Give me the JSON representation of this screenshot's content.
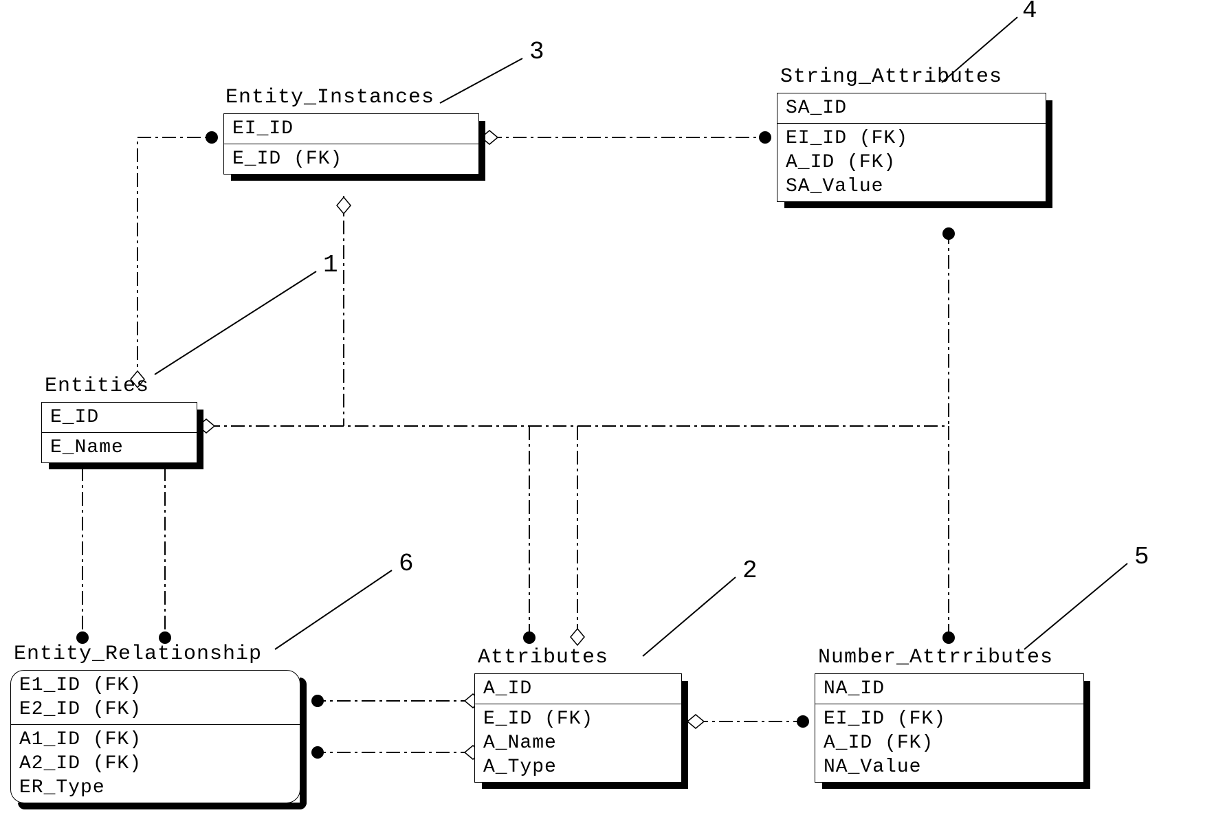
{
  "tables": {
    "entity_instances": {
      "title": "Entity_Instances",
      "pk": [
        "EI_ID"
      ],
      "attrs": [
        "E_ID (FK)"
      ],
      "callout": "3"
    },
    "string_attributes": {
      "title": "String_Attributes",
      "pk": [
        "SA_ID"
      ],
      "attrs": [
        "EI_ID (FK)",
        "A_ID (FK)",
        "SA_Value"
      ],
      "callout": "4"
    },
    "entities": {
      "title": "Entities",
      "pk": [
        "E_ID"
      ],
      "attrs": [
        "E_Name"
      ],
      "callout": "1"
    },
    "entity_relationship": {
      "title": "Entity_Relationship",
      "pk": [
        "E1_ID (FK)",
        "E2_ID (FK)"
      ],
      "attrs": [
        "A1_ID (FK)",
        "A2_ID (FK)",
        "ER_Type"
      ],
      "callout": "6"
    },
    "attributes": {
      "title": "Attributes",
      "pk": [
        "A_ID"
      ],
      "attrs": [
        "E_ID (FK)",
        "A_Name",
        "A_Type"
      ],
      "callout": "2"
    },
    "number_attributes": {
      "title": "Number_Attrributes",
      "pk": [
        "NA_ID"
      ],
      "attrs": [
        "EI_ID (FK)",
        "A_ID (FK)",
        "NA_Value"
      ],
      "callout": "5"
    }
  }
}
